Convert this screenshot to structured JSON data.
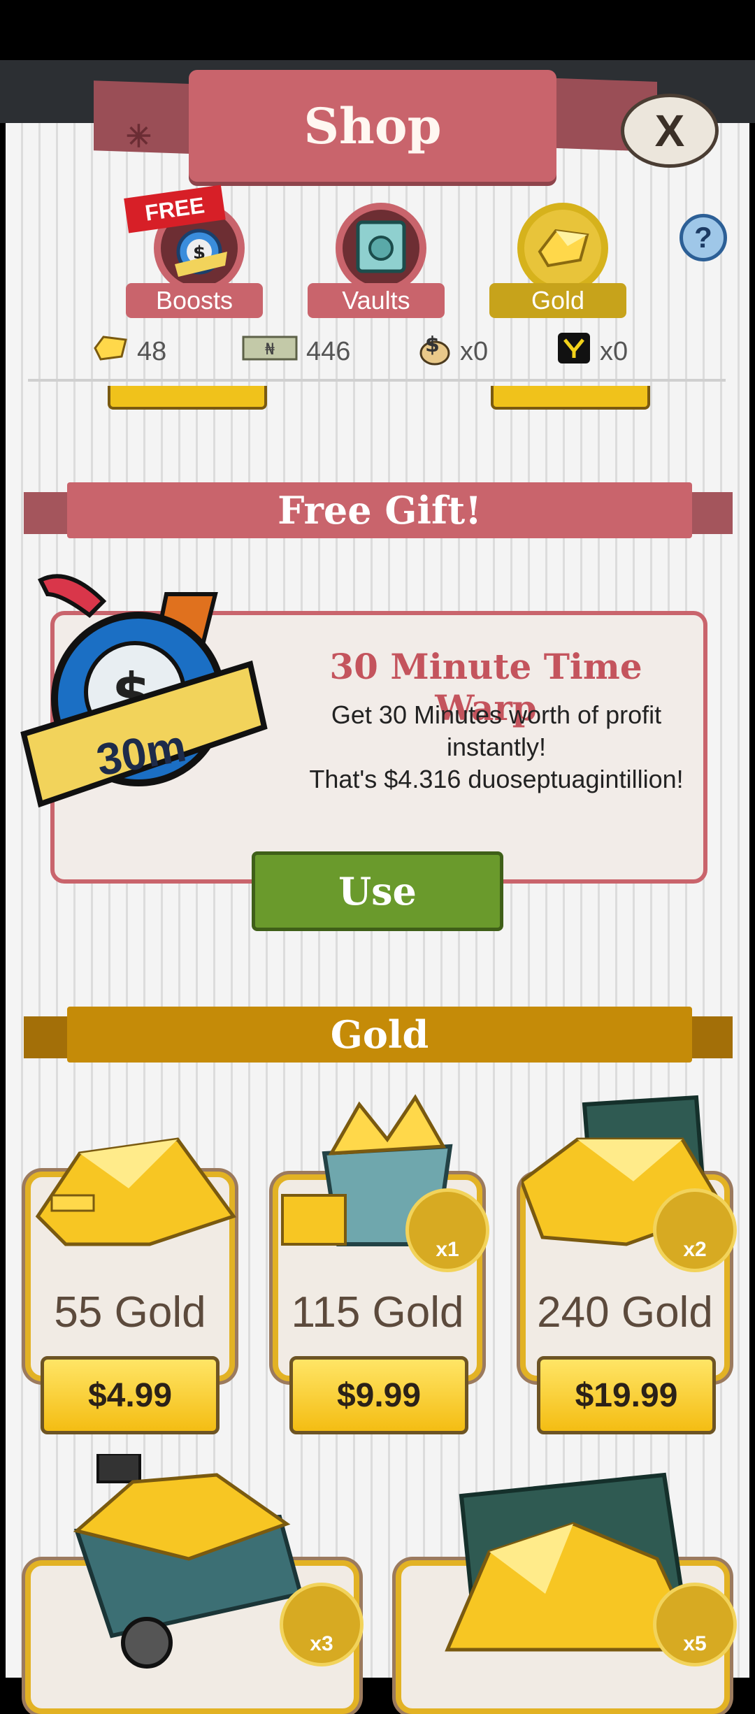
{
  "header": {
    "title": "Shop",
    "close_label": "X"
  },
  "tabs": [
    {
      "label": "Boosts",
      "ribbon": "FREE",
      "icon": "stopwatch-icon"
    },
    {
      "label": "Vaults",
      "icon": "vault-icon"
    },
    {
      "label": "Gold",
      "icon": "gold-icon",
      "selected": true
    }
  ],
  "help_label": "?",
  "currencies": [
    {
      "icon": "gold-gem-icon",
      "value": "48"
    },
    {
      "icon": "megabucks-icon",
      "value": "446"
    },
    {
      "icon": "moneybag-icon",
      "value": "x0"
    },
    {
      "icon": "megaticket-icon",
      "value": "x0"
    }
  ],
  "free_gift": {
    "section_title": "Free Gift!",
    "badge_text": "30m",
    "title": "30 Minute Time Warp",
    "line1": "Get 30 Minutes worth of profit",
    "line2": "instantly!",
    "line3": "That's $4.316 duoseptuagintillion!",
    "button_label": "Use"
  },
  "gold_section": {
    "title": "Gold",
    "items": [
      {
        "name": "55 Gold",
        "price": "$4.99",
        "multiplier": ""
      },
      {
        "name": "115 Gold",
        "price": "$9.99",
        "multiplier": "x1"
      },
      {
        "name": "240 Gold",
        "price": "$19.99",
        "multiplier": "x2"
      },
      {
        "name": "",
        "price": "",
        "multiplier": "x3"
      },
      {
        "name": "",
        "price": "",
        "multiplier": "x5"
      }
    ]
  },
  "colors": {
    "brand_red": "#c9646c",
    "gold": "#e2b224",
    "use_green": "#6a9a2c"
  }
}
